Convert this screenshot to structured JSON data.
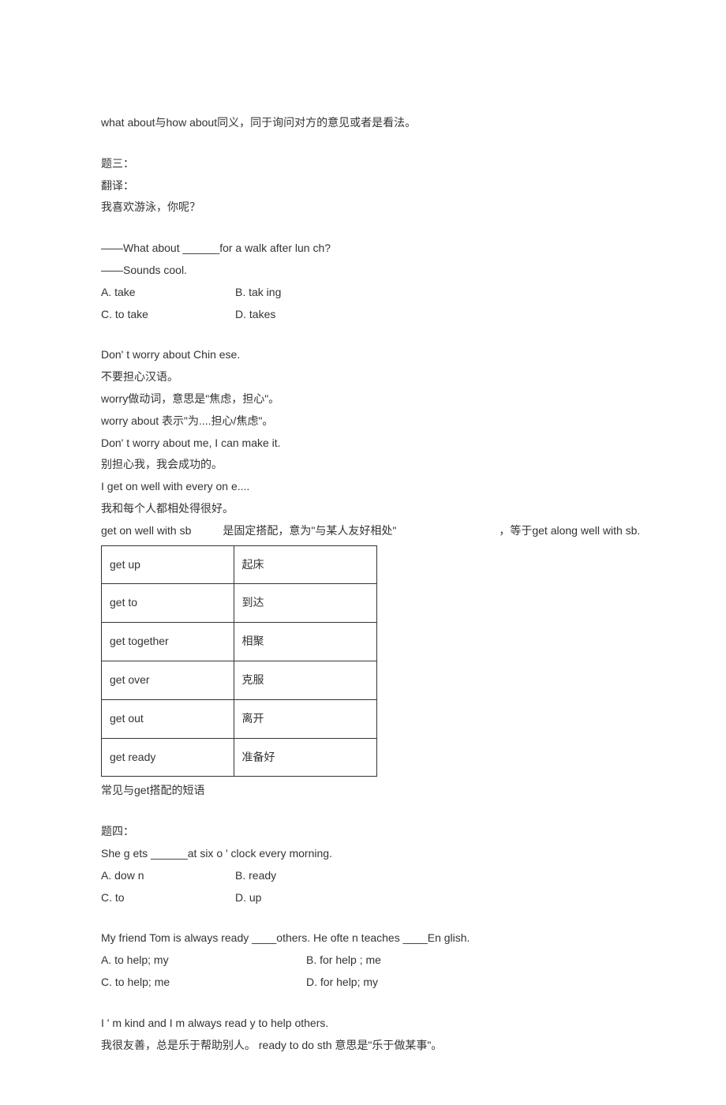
{
  "l1": "what about与how about同义，同于询问对方的意见或者是看法。",
  "l2": "题三：",
  "l3": "翻译：",
  "l4": "我喜欢游泳，你呢？",
  "l5": "——What about ______for a walk after lun ch?",
  "l6": "——Sounds cool.",
  "l7a": "A. take",
  "l7b": "B. tak ing",
  "l8a": "C. to take",
  "l8b": "D. takes",
  "l9": "Don' t worry about Chin ese.",
  "l10": "不要担心汉语。",
  "l11": "worry做动词，意思是\"焦虑，担心\"。",
  "l12": "worry about 表示\"为....担心/焦虑\"。",
  "l13": "Don' t worry about me, I can make it.",
  "l14": "别担心我，我会成功的。",
  "l15": "I get on well with every on e....",
  "l16": "我和每个人都相处得很好。",
  "l17a": "get on well with sb",
  "l17b": "是固定搭配，意为\"与某人友好相处\"",
  "l17c": "，等于get along well with sb.",
  "tbl": [
    [
      "get up",
      "起床"
    ],
    [
      "get to",
      "到达"
    ],
    [
      "get together",
      "相聚"
    ],
    [
      "get over",
      "克服"
    ],
    [
      "get out",
      "离开"
    ],
    [
      "get ready",
      "准备好"
    ]
  ],
  "l18": "常见与get搭配的短语",
  "l19": "题四：",
  "l20": "She g ets ______at six o ' clock every morning.",
  "l21a": "A. dow n",
  "l21b": "B. ready",
  "l22a": "C. to",
  "l22b": "D. up",
  "l23": "My friend Tom is always ready ____others. He ofte n teaches ____En glish.",
  "l24a": "A. to help; my",
  "l24b": "B. for help ; me",
  "l25a": "C. to help; me",
  "l25b": "D. for help; my",
  "l26": "I ' m kind and I        m always read y to help others.",
  "l27": "我很友善，总是乐于帮助别人。 ready to do sth 意思是\"乐于做某事\"。"
}
